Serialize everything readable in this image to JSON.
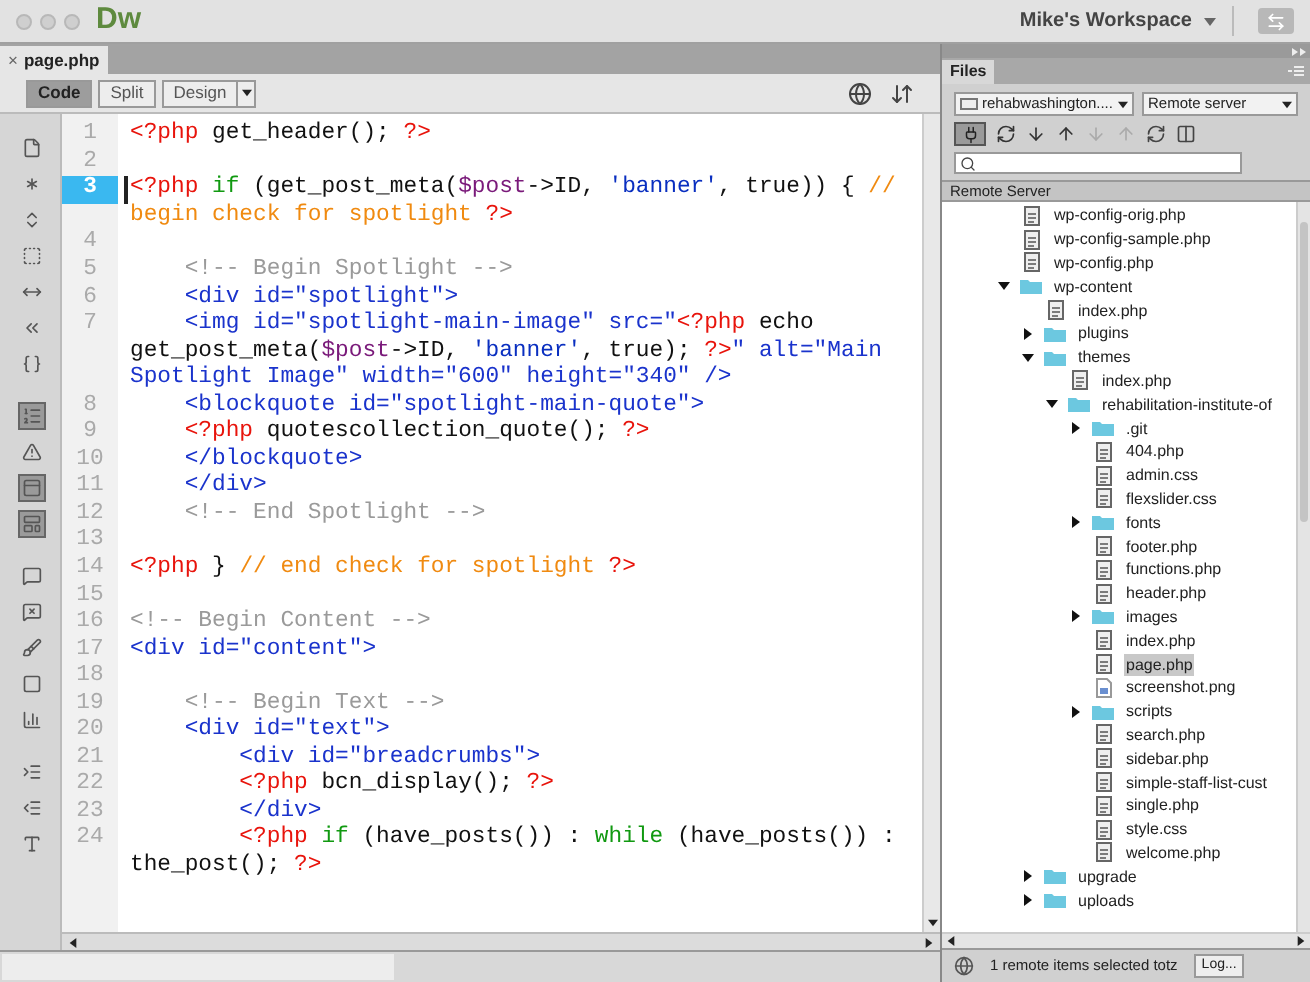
{
  "app": {
    "logo": "Dw",
    "workspace": "Mike's Workspace"
  },
  "document_tab": {
    "close": "×",
    "title": "page.php"
  },
  "view_buttons": [
    {
      "label": "Code",
      "selected": true
    },
    {
      "label": "Split",
      "selected": false
    },
    {
      "label": "Design",
      "selected": false
    }
  ],
  "editor_toolbar": [
    {
      "pressed": false
    },
    {
      "pressed": false
    },
    {
      "pressed": false
    },
    {
      "pressed": false
    },
    {
      "pressed": false
    },
    {
      "pressed": false
    },
    {
      "pressed": false
    },
    {
      "pressed": true
    },
    {
      "pressed": false
    },
    {
      "pressed": true
    },
    {
      "pressed": true
    },
    {
      "pressed": false
    },
    {
      "pressed": false
    },
    {
      "pressed": false
    },
    {
      "pressed": false
    },
    {
      "pressed": false
    },
    {
      "pressed": false
    },
    {
      "pressed": false
    },
    {
      "pressed": false
    }
  ],
  "code_rows": [
    {
      "number": "1",
      "current": false,
      "tokens": [
        {
          "kind": "php",
          "text": "<?php"
        },
        {
          "kind": "plain",
          "text": " get_header(); "
        },
        {
          "kind": "php",
          "text": "?>"
        }
      ]
    },
    {
      "number": "2",
      "current": false,
      "tokens": []
    },
    {
      "number": "3",
      "current": true,
      "tokens": [
        {
          "kind": "php",
          "text": "<?php "
        },
        {
          "kind": "keyword",
          "text": "if"
        },
        {
          "kind": "plain",
          "text": " (get_post_meta("
        },
        {
          "kind": "variable",
          "text": "$post"
        },
        {
          "kind": "plain",
          "text": "->ID, "
        },
        {
          "kind": "string",
          "text": "'banner'"
        },
        {
          "kind": "plain",
          "text": ", true)) { "
        },
        {
          "kind": "comment",
          "text": "//"
        }
      ]
    },
    {
      "current": false,
      "tokens": [
        {
          "kind": "comment",
          "text": "begin check for spotlight "
        },
        {
          "kind": "php",
          "text": "?>"
        }
      ]
    },
    {
      "number": "4",
      "current": false,
      "tokens": []
    },
    {
      "number": "5",
      "current": false,
      "tokens": [
        {
          "kind": "html_comment",
          "text": "    <!-- Begin Spotlight -->"
        }
      ]
    },
    {
      "number": "6",
      "current": false,
      "tokens": [
        {
          "kind": "tag",
          "text": "    <div id=\"spotlight\">"
        }
      ]
    },
    {
      "number": "7",
      "current": false,
      "tokens": [
        {
          "kind": "tag",
          "text": "    <img id=\"spotlight-main-image\" src=\""
        },
        {
          "kind": "php",
          "text": "<?php"
        },
        {
          "kind": "plain",
          "text": " echo"
        }
      ]
    },
    {
      "current": false,
      "tokens": [
        {
          "kind": "plain",
          "text": "get_post_meta("
        },
        {
          "kind": "variable",
          "text": "$post"
        },
        {
          "kind": "plain",
          "text": "->ID, "
        },
        {
          "kind": "string",
          "text": "'banner'"
        },
        {
          "kind": "plain",
          "text": ", true); "
        },
        {
          "kind": "php",
          "text": "?>"
        },
        {
          "kind": "tag",
          "text": "\" alt=\"Main"
        }
      ]
    },
    {
      "current": false,
      "tokens": [
        {
          "kind": "tag",
          "text": "Spotlight Image\" width=\"600\" height=\"340\" />"
        }
      ]
    },
    {
      "number": "8",
      "current": false,
      "tokens": [
        {
          "kind": "tag",
          "text": "    <blockquote id=\"spotlight-main-quote\">"
        }
      ]
    },
    {
      "number": "9",
      "current": false,
      "tokens": [
        {
          "kind": "php",
          "text": "    <?php"
        },
        {
          "kind": "plain",
          "text": " quotescollection_quote(); "
        },
        {
          "kind": "php",
          "text": "?>"
        }
      ]
    },
    {
      "number": "10",
      "current": false,
      "tokens": [
        {
          "kind": "tag",
          "text": "    </blockquote>"
        }
      ]
    },
    {
      "number": "11",
      "current": false,
      "tokens": [
        {
          "kind": "tag",
          "text": "    </div>"
        }
      ]
    },
    {
      "number": "12",
      "current": false,
      "tokens": [
        {
          "kind": "html_comment",
          "text": "    <!-- End Spotlight -->"
        }
      ]
    },
    {
      "number": "13",
      "current": false,
      "tokens": []
    },
    {
      "number": "14",
      "current": false,
      "tokens": [
        {
          "kind": "php",
          "text": "<?php"
        },
        {
          "kind": "plain",
          "text": " } "
        },
        {
          "kind": "comment",
          "text": "// end check for spotlight "
        },
        {
          "kind": "php",
          "text": "?>"
        }
      ]
    },
    {
      "number": "15",
      "current": false,
      "tokens": []
    },
    {
      "number": "16",
      "current": false,
      "tokens": [
        {
          "kind": "html_comment",
          "text": "<!-- Begin Content -->"
        }
      ]
    },
    {
      "number": "17",
      "current": false,
      "tokens": [
        {
          "kind": "tag",
          "text": "<div id=\"content\">"
        }
      ]
    },
    {
      "number": "18",
      "current": false,
      "tokens": []
    },
    {
      "number": "19",
      "current": false,
      "tokens": [
        {
          "kind": "html_comment",
          "text": "    <!-- Begin Text -->"
        }
      ]
    },
    {
      "number": "20",
      "current": false,
      "tokens": [
        {
          "kind": "tag",
          "text": "    <div id=\"text\">"
        }
      ]
    },
    {
      "number": "21",
      "current": false,
      "tokens": [
        {
          "kind": "tag",
          "text": "        <div id=\"breadcrumbs\">"
        }
      ]
    },
    {
      "number": "22",
      "current": false,
      "tokens": [
        {
          "kind": "php",
          "text": "        <?php"
        },
        {
          "kind": "plain",
          "text": " bcn_display(); "
        },
        {
          "kind": "php",
          "text": "?>"
        }
      ]
    },
    {
      "number": "23",
      "current": false,
      "tokens": [
        {
          "kind": "tag",
          "text": "        </div>"
        }
      ]
    },
    {
      "number": "24",
      "current": false,
      "tokens": [
        {
          "kind": "php",
          "text": "        <?php "
        },
        {
          "kind": "keyword",
          "text": "if"
        },
        {
          "kind": "plain",
          "text": " (have_posts()) : "
        },
        {
          "kind": "keyword",
          "text": "while"
        },
        {
          "kind": "plain",
          "text": " (have_posts()) :"
        }
      ]
    },
    {
      "current": false,
      "tokens": [
        {
          "kind": "plain",
          "text": "the_post(); "
        },
        {
          "kind": "php",
          "text": "?>"
        }
      ]
    }
  ],
  "files_panel": {
    "tab": "Files",
    "site": "rehabwashington....",
    "view": "Remote server",
    "header": "Remote Server",
    "tree": [
      {
        "name": "wp-config-orig.php",
        "kind": "file",
        "selected": false
      },
      {
        "name": "wp-config-sample.php",
        "kind": "file",
        "selected": false
      },
      {
        "name": "wp-config.php",
        "kind": "file",
        "selected": false
      },
      {
        "name": "wp-content",
        "kind": "folder",
        "expanded": true,
        "selected": false,
        "children": [
          {
            "name": "index.php",
            "kind": "file",
            "selected": false
          },
          {
            "name": "plugins",
            "kind": "folder",
            "expanded": false,
            "selected": false
          },
          {
            "name": "themes",
            "kind": "folder",
            "expanded": true,
            "selected": false,
            "children": [
              {
                "name": "index.php",
                "kind": "file",
                "selected": false
              },
              {
                "name": "rehabilitation-institute-of",
                "kind": "folder",
                "expanded": true,
                "selected": false,
                "children": [
                  {
                    "name": ".git",
                    "kind": "folder",
                    "expanded": false,
                    "selected": false
                  },
                  {
                    "name": "404.php",
                    "kind": "file",
                    "selected": false
                  },
                  {
                    "name": "admin.css",
                    "kind": "file",
                    "selected": false
                  },
                  {
                    "name": "flexslider.css",
                    "kind": "file",
                    "selected": false
                  },
                  {
                    "name": "fonts",
                    "kind": "folder",
                    "expanded": false,
                    "selected": false
                  },
                  {
                    "name": "footer.php",
                    "kind": "file",
                    "selected": false
                  },
                  {
                    "name": "functions.php",
                    "kind": "file",
                    "selected": false
                  },
                  {
                    "name": "header.php",
                    "kind": "file",
                    "selected": false
                  },
                  {
                    "name": "images",
                    "kind": "folder",
                    "expanded": false,
                    "selected": false
                  },
                  {
                    "name": "index.php",
                    "kind": "file",
                    "selected": false
                  },
                  {
                    "name": "page.php",
                    "kind": "file",
                    "selected": true
                  },
                  {
                    "name": "screenshot.png",
                    "kind": "image",
                    "selected": false
                  },
                  {
                    "name": "scripts",
                    "kind": "folder",
                    "expanded": false,
                    "selected": false
                  },
                  {
                    "name": "search.php",
                    "kind": "file",
                    "selected": false
                  },
                  {
                    "name": "sidebar.php",
                    "kind": "file",
                    "selected": false
                  },
                  {
                    "name": "simple-staff-list-cust",
                    "kind": "file",
                    "selected": false
                  },
                  {
                    "name": "single.php",
                    "kind": "file",
                    "selected": false
                  },
                  {
                    "name": "style.css",
                    "kind": "file",
                    "selected": false
                  },
                  {
                    "name": "welcome.php",
                    "kind": "file",
                    "selected": false
                  }
                ]
              }
            ]
          },
          {
            "name": "upgrade",
            "kind": "folder",
            "expanded": false,
            "selected": false
          },
          {
            "name": "uploads",
            "kind": "folder",
            "expanded": false,
            "selected": false
          }
        ]
      }
    ],
    "status": "1 remote items selected totz",
    "log_button": "Log..."
  }
}
